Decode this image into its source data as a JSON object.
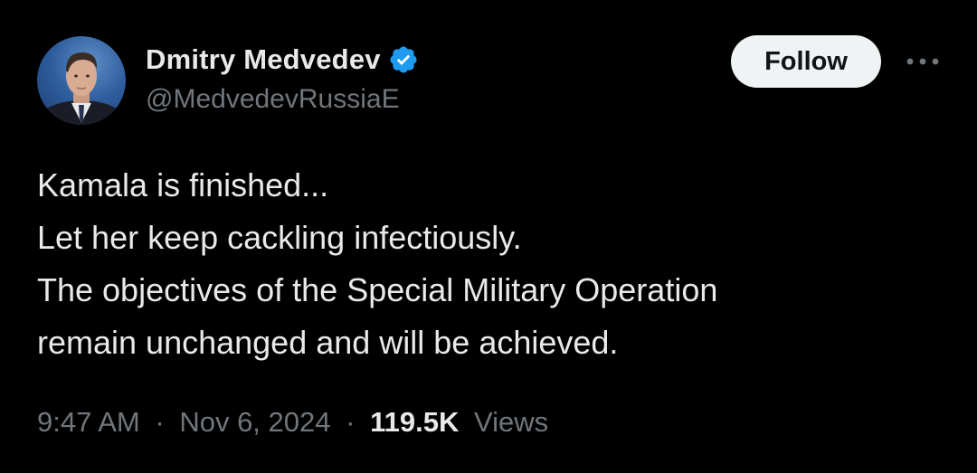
{
  "author": {
    "display_name": "Dmitry Medvedev",
    "handle": "@MedvedevRussiaE",
    "verified_icon": "verified-badge-icon"
  },
  "actions": {
    "follow_label": "Follow",
    "more_icon": "more-horizontal-icon"
  },
  "tweet": {
    "lines": [
      "Kamala is finished...",
      "Let her keep cackling infectiously.",
      "The objectives of the Special Military Operation",
      "remain unchanged and will be achieved."
    ]
  },
  "meta": {
    "time": "9:47 AM",
    "separator": "·",
    "date": "Nov 6, 2024",
    "views_count": "119.5K",
    "views_label": "Views"
  },
  "colors": {
    "background": "#000000",
    "primary_text": "#e7e9ea",
    "secondary_text": "#71767b",
    "follow_bg": "#eff3f4",
    "verified": "#1d9bf0"
  }
}
